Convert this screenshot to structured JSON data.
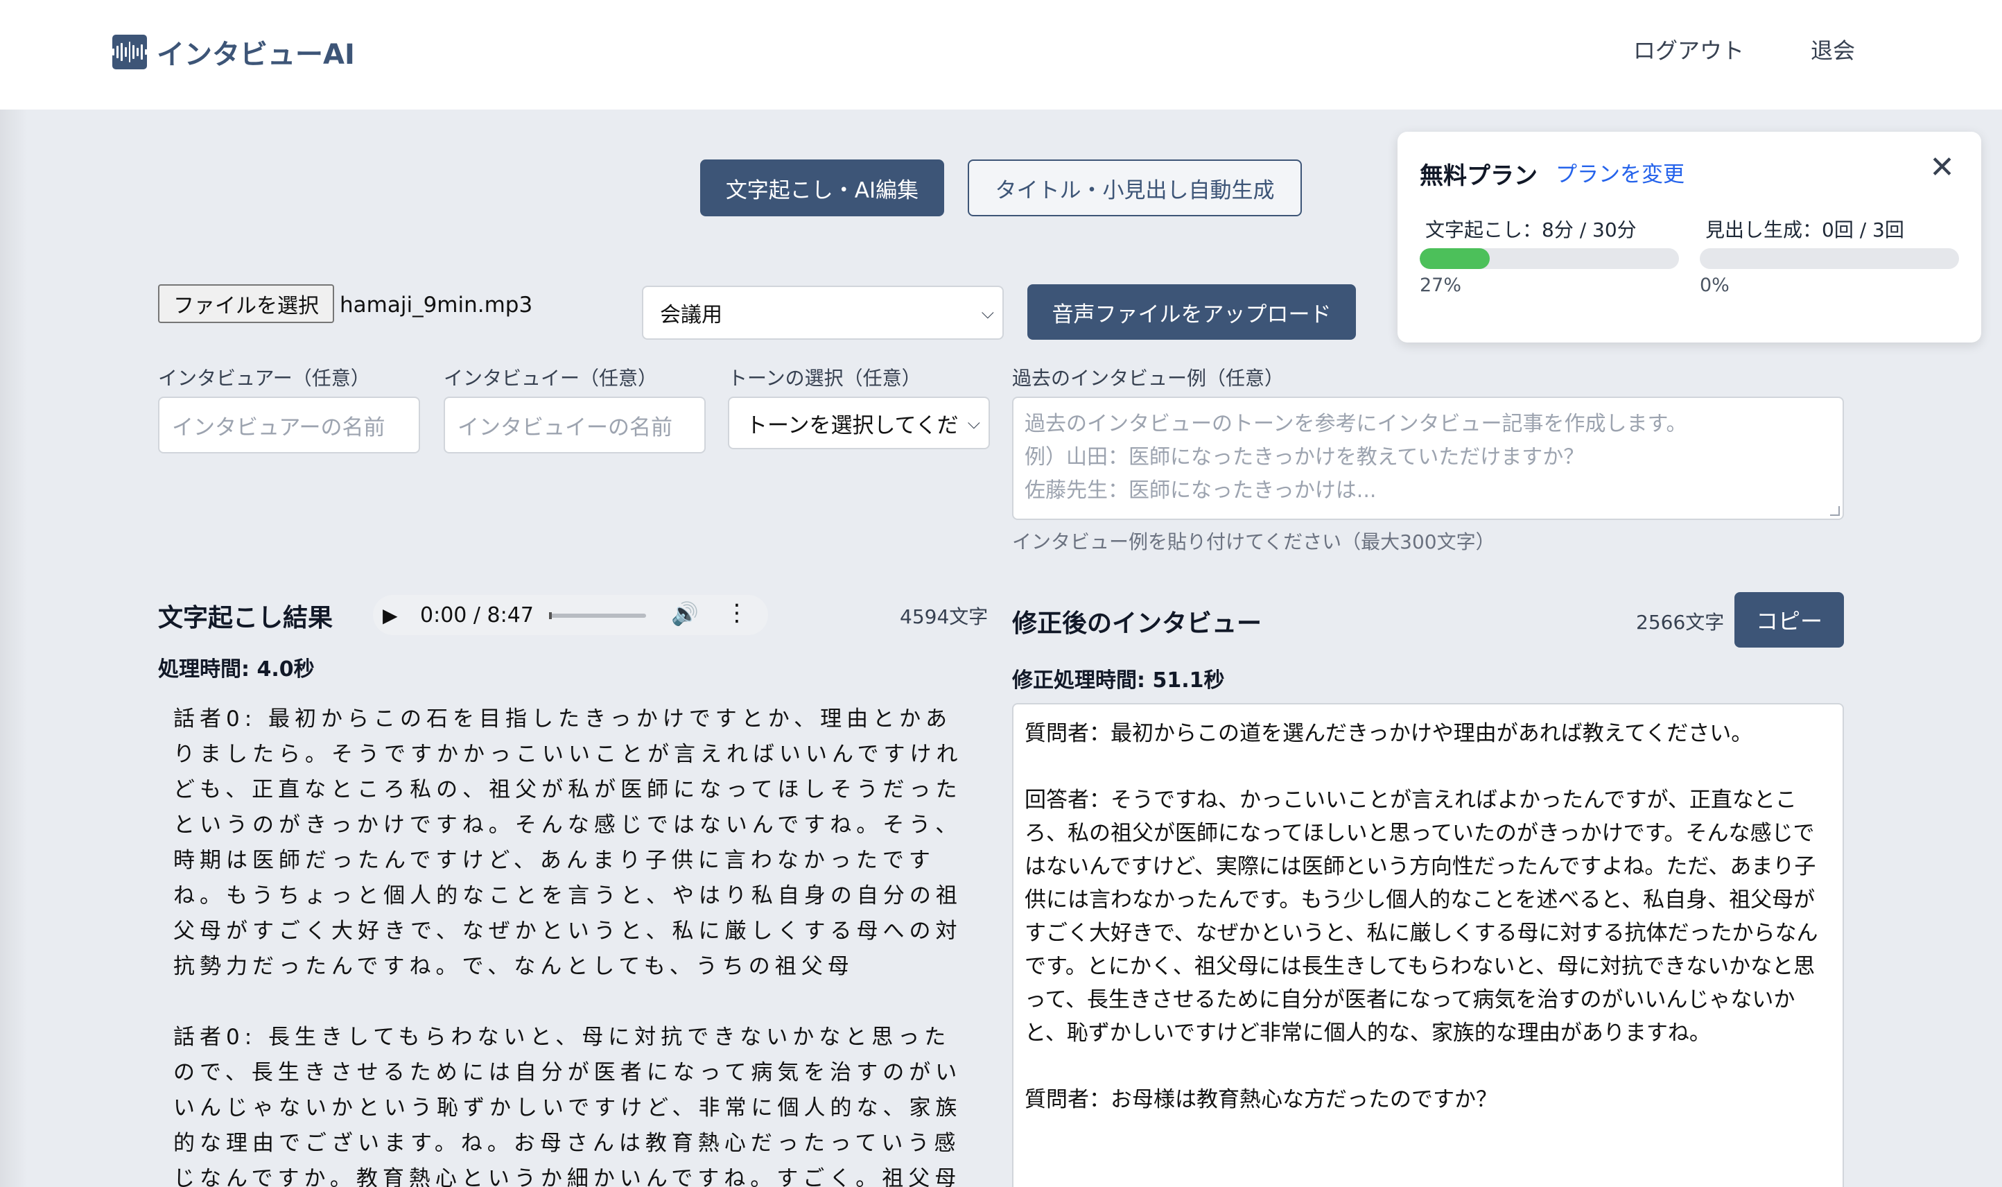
{
  "header": {
    "app_name": "インタビューAI",
    "logout": "ログアウト",
    "withdraw": "退会"
  },
  "modes": {
    "active": "文字起こし・AI編集",
    "inactive": "タイトル・小見出し自動生成"
  },
  "plan": {
    "title": "無料プラン",
    "change_link": "プランを変更",
    "close": "✕",
    "transcription_label": "文字起こし：8分 / 30分",
    "transcription_pct": "27%",
    "transcription_fraction": 0.27,
    "headline_label": "見出し生成：0回 / 3回",
    "headline_pct": "0%",
    "headline_fraction": 0,
    "bar_color": "#4cc05a"
  },
  "upload": {
    "file_button": "ファイルを選択",
    "file_name": "hamaji_9min.mp3",
    "purpose_value": "会議用",
    "upload_button": "音声ファイルをアップロード"
  },
  "fields": {
    "interviewer_label": "インタビュアー（任意）",
    "interviewer_placeholder": "インタビュアーの名前",
    "interviewee_label": "インタビュイー（任意）",
    "interviewee_placeholder": "インタビュイーの名前",
    "tone_label": "トーンの選択（任意）",
    "tone_value": "トーンを選択してくだ",
    "examples_label": "過去のインタビュー例（任意）",
    "examples_placeholder_1": "過去のインタビューのトーンを参考にインタビュー記事を作成します。",
    "examples_placeholder_2": "例）山田：医師になったきっかけを教えていただけますか？",
    "examples_placeholder_3": "佐藤先生：医師になったきっかけは...",
    "examples_hint": "インタビュー例を貼り付けてください（最大300文字）"
  },
  "transcript": {
    "title": "文字起こし結果",
    "player_time": "0:00 / 8:47",
    "char_count": "4594文字",
    "processing_time": "処理時間: 4.0秒",
    "paragraph_1": "話者0: 最初からこの石を目指したきっかけですとか、理由とかありましたら。そうですかかっこいいことが言えればいいんですけれども、正直なところ私の、祖父が私が医師になってほしそうだったというのがきっかけですね。そんな感じではないんですね。そう、時期は医師だったんですけど、あんまり子供に言わなかったですね。もうちょっと個人的なことを言うと、やはり私自身の自分の祖父母がすごく大好きで、なぜかというと、私に厳しくする母への対抗勢力だったんですね。で、なんとしても、うちの祖父母",
    "paragraph_2": "話者0: 長生きしてもらわないと、母に対抗できないかなと思ったので、長生きさせるためには自分が医者になって病気を治すのがいいんじゃないかという恥ずかしいですけど、非常に個人的な、家族的な理由でございます。ね。お母さんは教育熱心だったっていう感じなんですか。教育熱心というか細かいんですね。すごく。祖父母"
  },
  "edited": {
    "title": "修正後のインタビュー",
    "char_count": "2566文字",
    "copy_button": "コピー",
    "processing_time": "修正処理時間: 51.1秒",
    "paragraph_1": "質問者：最初からこの道を選んだきっかけや理由があれば教えてください。",
    "paragraph_2": "回答者：そうですね、かっこいいことが言えればよかったんですが、正直なところ、私の祖父が医師になってほしいと思っていたのがきっかけです。そんな感じではないんですけど、実際には医師という方向性だったんですよね。ただ、あまり子供には言わなかったんです。もう少し個人的なことを述べると、私自身、祖父母がすごく大好きで、なぜかというと、私に厳しくする母に対する抗体だったからなんです。とにかく、祖父母には長生きしてもらわないと、母に対抗できないかなと思って、長生きさせるために自分が医者になって病気を治すのがいいんじゃないかと、恥ずかしいですけど非常に個人的な、家族的な理由がありますね。",
    "paragraph_3": "質問者：お母様は教育熱心な方だったのですか？"
  },
  "colors": {
    "brand": "#3d5577",
    "link": "#2563eb"
  },
  "icons": {
    "logo": "waveform-icon",
    "play": "play-icon",
    "volume": "volume-icon",
    "more": "more-vertical-icon",
    "close": "close-icon",
    "select": "chevron-down-icon"
  }
}
